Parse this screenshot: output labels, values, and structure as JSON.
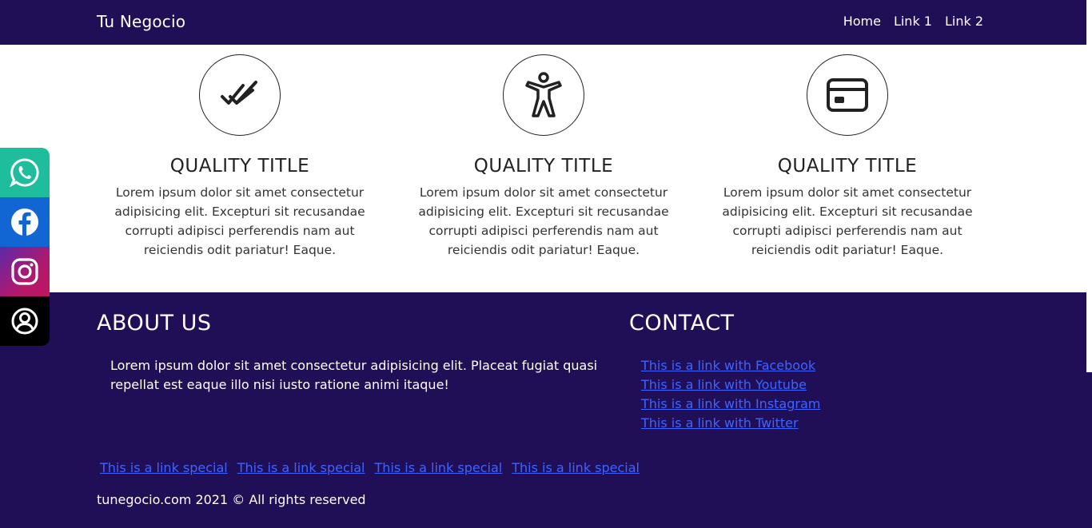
{
  "navbar": {
    "brand": "Tu Negocio",
    "links": [
      "Home",
      "Link 1",
      "Link 2"
    ]
  },
  "qualities": [
    {
      "icon": "double-check-icon",
      "title": "QUALITY TITLE",
      "text": "Lorem ipsum dolor sit amet consectetur adipisicing elit. Excepturi sit recusandae corrupti adipisci perferendis nam aut reiciendis odit pariatur! Eaque."
    },
    {
      "icon": "accessibility-icon",
      "title": "QUALITY TITLE",
      "text": "Lorem ipsum dolor sit amet consectetur adipisicing elit. Excepturi sit recusandae corrupti adipisci perferendis nam aut reiciendis odit pariatur! Eaque."
    },
    {
      "icon": "credit-card-icon",
      "title": "QUALITY TITLE",
      "text": "Lorem ipsum dolor sit amet consectetur adipisicing elit. Excepturi sit recusandae corrupti adipisci perferendis nam aut reiciendis odit pariatur! Eaque."
    }
  ],
  "footer": {
    "about_title": "ABOUT US",
    "about_text": "Lorem ipsum dolor sit amet consectetur adipisicing elit. Placeat fugiat quasi repellat est eaque illo nisi iusto ratione animi itaque!",
    "contact_title": "CONTACT",
    "contact_links": [
      "This is a link with Facebook",
      "This is a link with Youtube",
      "This is a link with Instagram",
      "This is a link with Twitter"
    ],
    "special_links": [
      "This is a link special",
      "This is a link special",
      "This is a link special",
      "This is a link special"
    ],
    "copyright": "tunegocio.com 2021 © All rights reserved"
  },
  "social": [
    {
      "icon": "whatsapp-icon",
      "color": "#1ebd9c"
    },
    {
      "icon": "facebook-icon",
      "color": "#1266d4"
    },
    {
      "icon": "instagram-icon",
      "color": "#b0186e"
    },
    {
      "icon": "user-icon",
      "color": "#000000"
    }
  ],
  "colors": {
    "primary": "#200f57",
    "link": "#3f63ff",
    "text": "#212121"
  }
}
